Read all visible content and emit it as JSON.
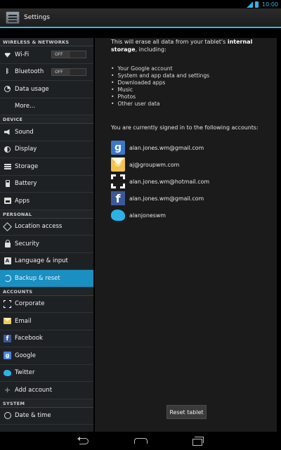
{
  "status_bar": {
    "time": "10:00"
  },
  "action_bar": {
    "title": "Settings"
  },
  "sidebar": {
    "sections": [
      {
        "header": "WIRELESS & NETWORKS",
        "items": [
          {
            "label": "Wi-Fi",
            "icon": "wifi-icon",
            "toggle": "OFF"
          },
          {
            "label": "Bluetooth",
            "icon": "bluetooth-icon",
            "toggle": "OFF"
          },
          {
            "label": "Data usage",
            "icon": "data-usage-icon"
          },
          {
            "label": "More...",
            "icon": ""
          }
        ]
      },
      {
        "header": "DEVICE",
        "items": [
          {
            "label": "Sound",
            "icon": "sound-icon"
          },
          {
            "label": "Display",
            "icon": "display-icon"
          },
          {
            "label": "Storage",
            "icon": "storage-icon"
          },
          {
            "label": "Battery",
            "icon": "battery-icon"
          },
          {
            "label": "Apps",
            "icon": "apps-icon"
          }
        ]
      },
      {
        "header": "PERSONAL",
        "items": [
          {
            "label": "Location access",
            "icon": "location-icon"
          },
          {
            "label": "Security",
            "icon": "lock-icon"
          },
          {
            "label": "Language & input",
            "icon": "language-icon"
          },
          {
            "label": "Backup & reset",
            "icon": "backup-icon",
            "active": true
          }
        ]
      },
      {
        "header": "ACCOUNTS",
        "items": [
          {
            "label": "Corporate",
            "icon": "corporate-icon"
          },
          {
            "label": "Email",
            "icon": "email-icon"
          },
          {
            "label": "Facebook",
            "icon": "facebook-icon"
          },
          {
            "label": "Google",
            "icon": "google-icon"
          },
          {
            "label": "Twitter",
            "icon": "twitter-icon"
          },
          {
            "label": "Add account",
            "icon": "plus-icon"
          }
        ]
      },
      {
        "header": "SYSTEM",
        "items": [
          {
            "label": "Date & time",
            "icon": "clock-icon"
          }
        ]
      }
    ]
  },
  "content": {
    "intro_prefix": "This will erase all data from your tablet's ",
    "intro_bold": "internal storage",
    "intro_suffix": ", including:",
    "data_items": [
      "Your Google account",
      "System and app data and settings",
      "Downloaded apps",
      "Music",
      "Photos",
      "Other user data"
    ],
    "signed_in_text": "You are currently signed in to the following accounts:",
    "accounts": [
      {
        "icon": "google-icon",
        "email": "alan.jones.wm@gmail.com"
      },
      {
        "icon": "email-icon",
        "email": "aj@groupwm.com"
      },
      {
        "icon": "corporate-icon",
        "email": "alan.jones.wm@hotmail.com"
      },
      {
        "icon": "facebook-icon",
        "email": "alan.jones.wm@gmail.com"
      },
      {
        "icon": "twitter-icon",
        "email": "alanjoneswm"
      }
    ],
    "reset_button": "Reset tablet"
  },
  "colors": {
    "accent": "#33b5e5",
    "active_item": "#1a8fc2",
    "sidebar_bg": "#1e2124",
    "content_bg": "#1b1b1b"
  }
}
